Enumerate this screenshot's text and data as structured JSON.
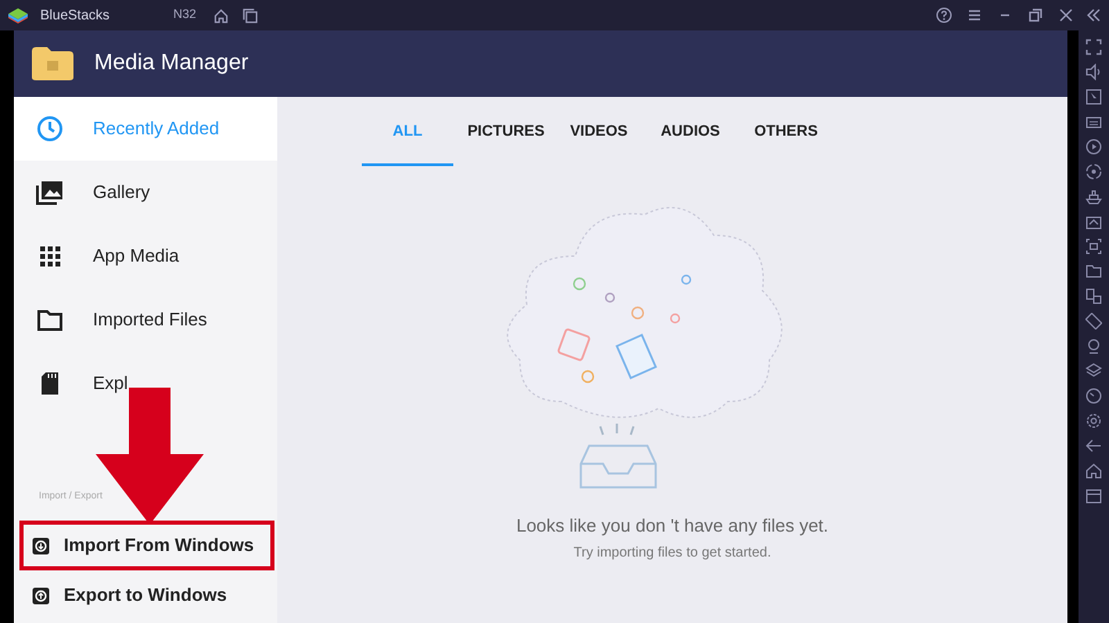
{
  "title_bar": {
    "app_name": "BlueStacks",
    "instance": "N32"
  },
  "header": {
    "title": "Media Manager"
  },
  "sidebar": {
    "items": [
      {
        "label": "Recently Added",
        "selected": true
      },
      {
        "label": "Gallery",
        "selected": false
      },
      {
        "label": "App Media",
        "selected": false
      },
      {
        "label": "Imported Files",
        "selected": false
      },
      {
        "label": "Expl",
        "selected": false
      }
    ],
    "section_label": "Import / Export",
    "actions": [
      {
        "label": "Import From Windows",
        "highlighted": true
      },
      {
        "label": "Export to Windows",
        "highlighted": false
      }
    ]
  },
  "tabs": [
    {
      "label": "ALL",
      "selected": true
    },
    {
      "label": "PICTURES",
      "selected": false
    },
    {
      "label": "VIDEOS",
      "selected": false
    },
    {
      "label": "AUDIOS",
      "selected": false
    },
    {
      "label": "OTHERS",
      "selected": false
    }
  ],
  "empty_state": {
    "message": "Looks like you don 't have any files yet.",
    "hint": "Try importing files to get started."
  }
}
